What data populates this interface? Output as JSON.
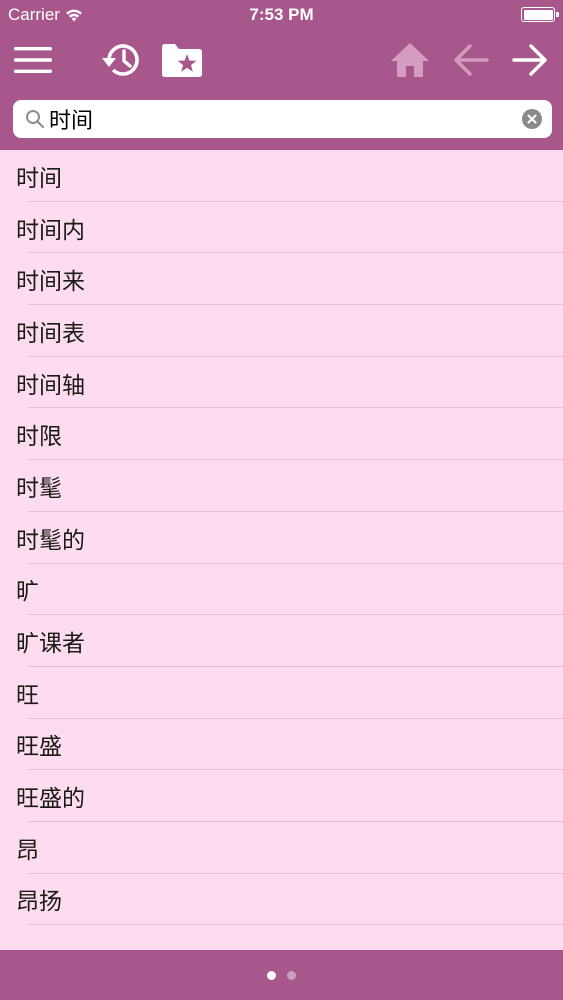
{
  "status": {
    "carrier": "Carrier",
    "time": "7:53 PM"
  },
  "toolbar": {
    "icons": [
      "menu-icon",
      "history-icon",
      "favorites-folder-icon",
      "home-icon",
      "back-arrow-icon",
      "forward-arrow-icon"
    ]
  },
  "search": {
    "value": "时间",
    "placeholder": ""
  },
  "list": {
    "items": [
      {
        "label": "时间"
      },
      {
        "label": "时间内"
      },
      {
        "label": "时间来"
      },
      {
        "label": "时间表"
      },
      {
        "label": "时间轴"
      },
      {
        "label": "时限"
      },
      {
        "label": "时髦"
      },
      {
        "label": "时髦的"
      },
      {
        "label": "旷"
      },
      {
        "label": "旷课者"
      },
      {
        "label": "旺"
      },
      {
        "label": "旺盛"
      },
      {
        "label": "旺盛的"
      },
      {
        "label": "昂"
      },
      {
        "label": "昂扬"
      }
    ]
  },
  "pager": {
    "count": 2,
    "active": 1
  },
  "colors": {
    "bar": "#a8578d",
    "list_bg": "#fddcf0",
    "separator": "#e9bcd6",
    "disabled_icon": "#d39cc0"
  }
}
